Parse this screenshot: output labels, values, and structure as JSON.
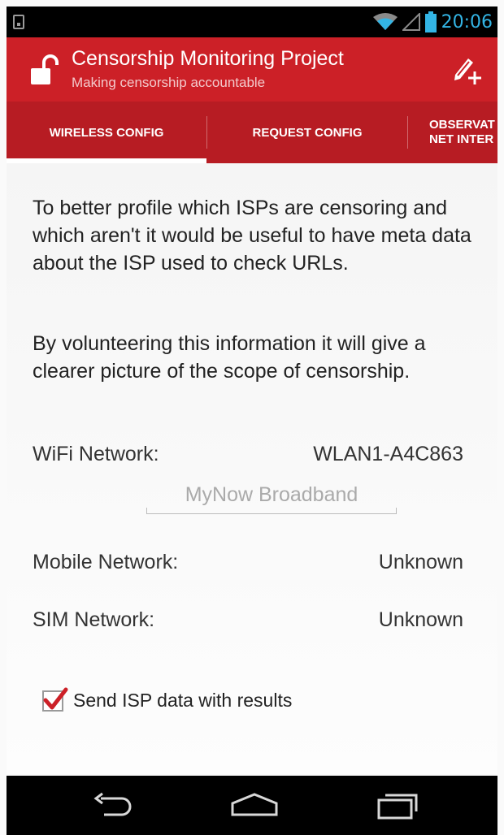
{
  "status_bar": {
    "time": "20:06",
    "icons": [
      "notification-icon",
      "wifi-icon",
      "signal-icon",
      "battery-icon"
    ]
  },
  "action_bar": {
    "title": "Censorship Monitoring Project",
    "subtitle": "Making censorship accountable",
    "app_icon": "unlocked-padlock-icon",
    "action_icon": "edit-add-icon",
    "color": "#cc2027"
  },
  "tabs": [
    {
      "label": "WIRELESS CONFIG",
      "selected": true
    },
    {
      "label": "REQUEST CONFIG",
      "selected": false
    },
    {
      "label_line1": "OBSERVAT",
      "label_line2": "NET INTER",
      "selected": false
    }
  ],
  "content": {
    "paragraph_1": "To better profile which ISPs are censoring and which aren't it would be useful to have meta data about the ISP used to check URLs.",
    "paragraph_2": "By volunteering this information it will give a clearer picture of the scope of censorship.",
    "wifi": {
      "label": "WiFi Network:",
      "value": "WLAN1-A4C863"
    },
    "isp_input": {
      "placeholder": "MyNow Broadband",
      "value": ""
    },
    "mobile": {
      "label": "Mobile Network:",
      "value": "Unknown"
    },
    "sim": {
      "label": "SIM Network:",
      "value": "Unknown"
    },
    "checkbox": {
      "label": "Send ISP data with results",
      "checked": true
    }
  },
  "nav_bar": {
    "buttons": [
      "back-icon",
      "home-icon",
      "recent-apps-icon"
    ]
  },
  "colors": {
    "accent": "#cc2027",
    "tab_bar": "#b71c23",
    "status_time": "#33b5e5",
    "check_mark": "#cc2027"
  }
}
